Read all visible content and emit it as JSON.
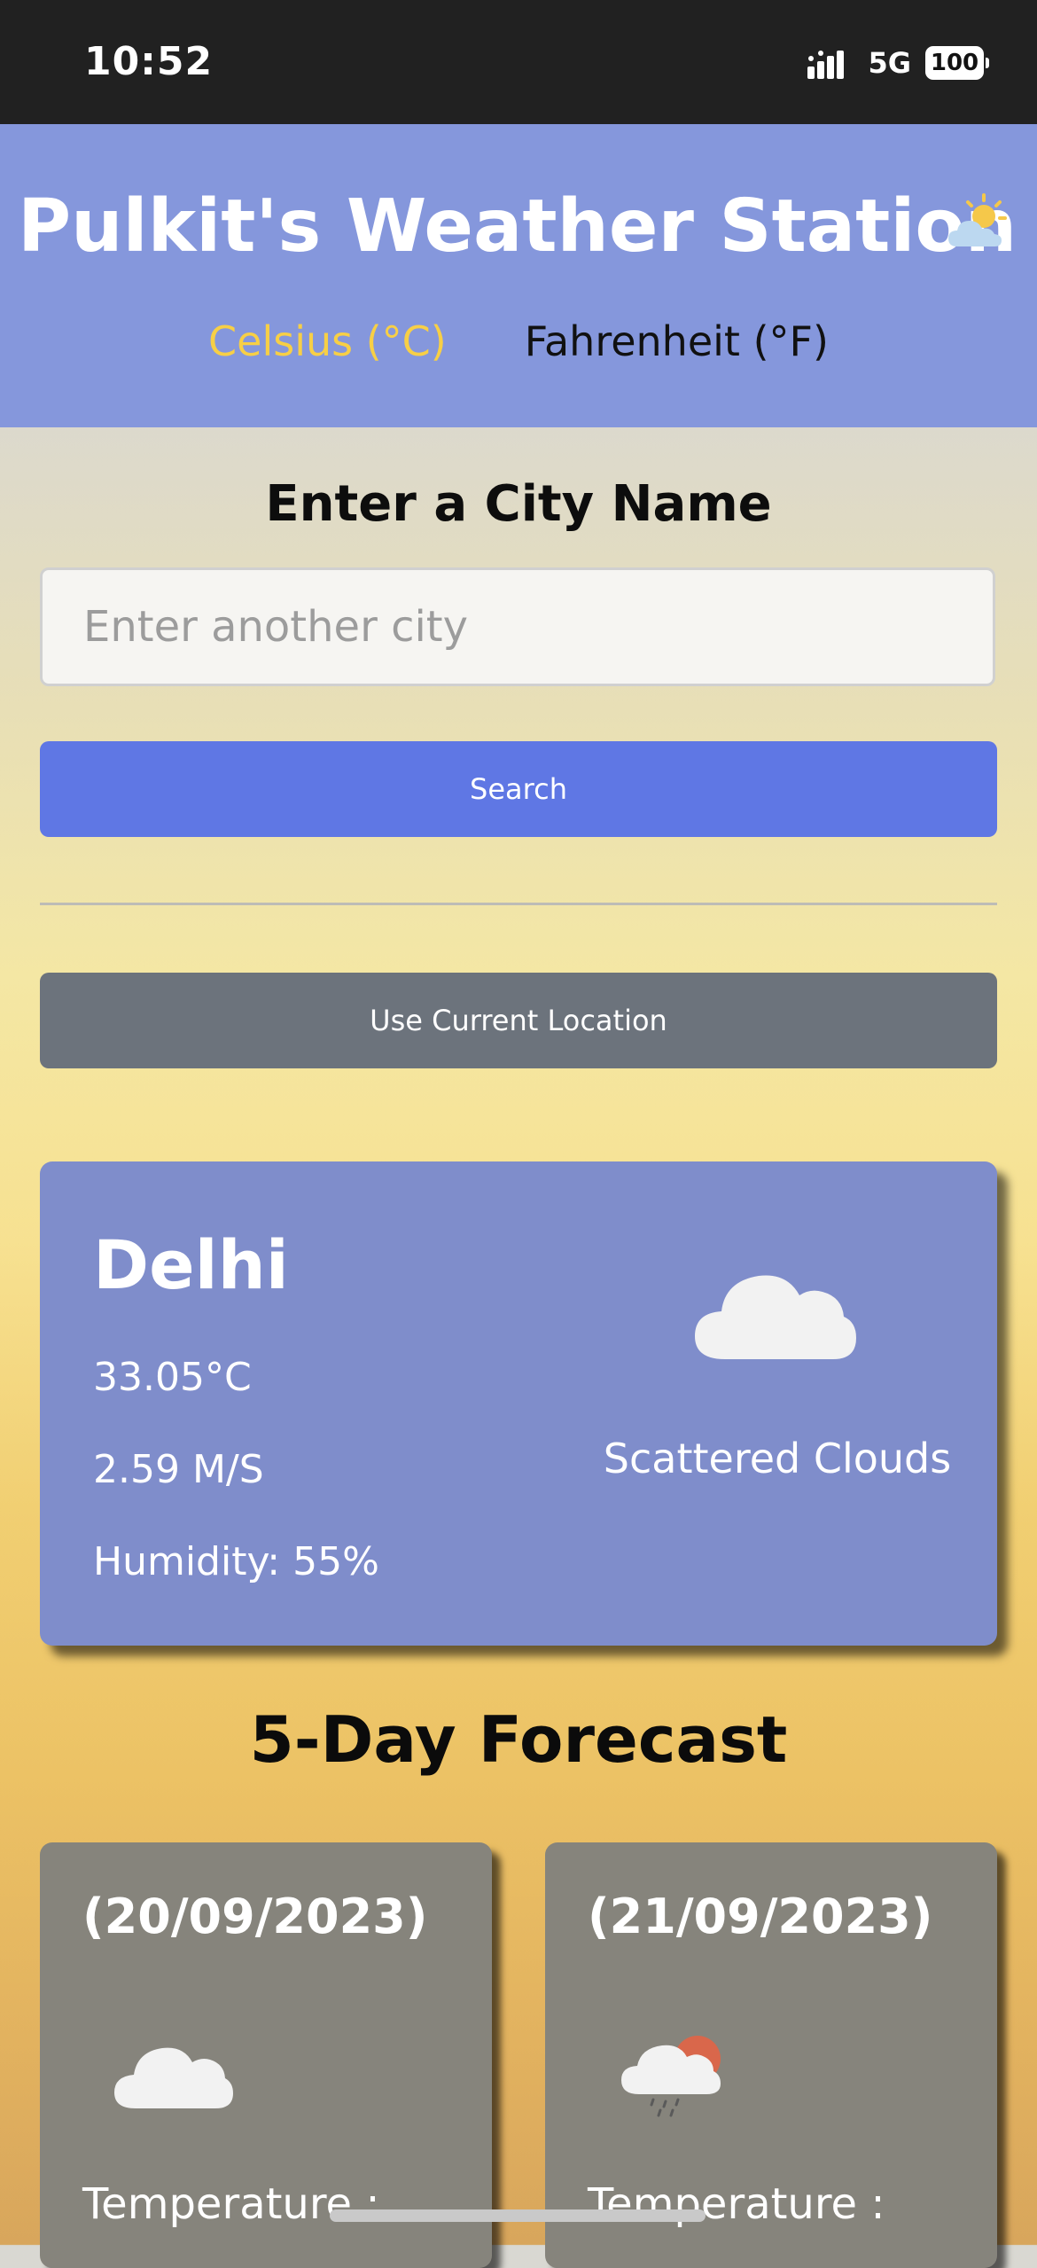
{
  "status_bar": {
    "time": "10:52",
    "network": "5G",
    "battery": "100"
  },
  "header": {
    "title": "Pulkit's Weather Station",
    "title_icon": "partly-sunny-icon",
    "units": {
      "celsius_label": "Celsius (°C)",
      "fahrenheit_label": "Fahrenheit (°F)",
      "selected": "celsius"
    }
  },
  "search": {
    "heading": "Enter a City Name",
    "placeholder": "Enter another city",
    "value": "",
    "search_label": "Search",
    "location_label": "Use Current Location"
  },
  "current": {
    "city": "Delhi",
    "temperature": "33.05°C",
    "wind": "2.59 M/S",
    "humidity": "Humidity: 55%",
    "condition": "Scattered Clouds",
    "icon": "cloud-icon"
  },
  "forecast": {
    "heading": "5-Day Forecast",
    "days": [
      {
        "date": "(20/09/2023)",
        "icon": "cloud-icon",
        "temp_label": "Temperature :"
      },
      {
        "date": "(21/09/2023)",
        "icon": "sun-rain-cloud-icon",
        "temp_label": "Temperature :"
      }
    ]
  },
  "colors": {
    "header_bg": "#8597dc",
    "accent_celsius": "#f7cf46",
    "search_button": "#5f77e4",
    "location_button": "#6c737c",
    "current_card": "#7f8dcb",
    "forecast_card": "#86847c"
  }
}
